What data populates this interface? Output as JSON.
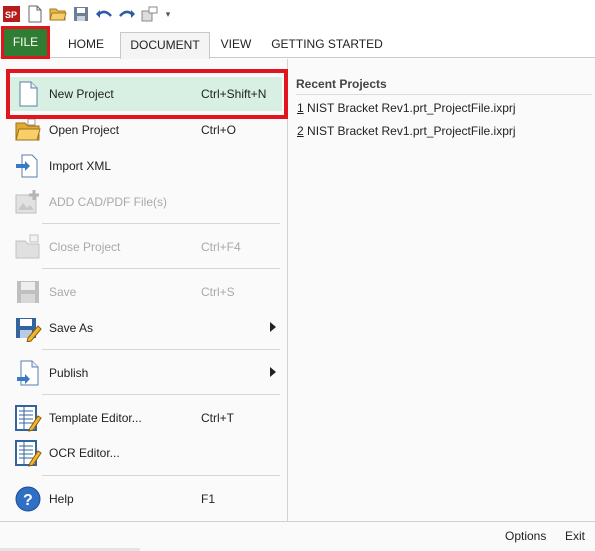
{
  "quick_access": {
    "icons": [
      "app-logo-icon",
      "new-file-icon",
      "open-folder-icon",
      "save-icon",
      "undo-icon",
      "redo-icon",
      "publish-icon",
      "customize-dropdown-icon"
    ]
  },
  "ribbon": {
    "file_label": "FILE",
    "tabs": [
      {
        "label": "HOME"
      },
      {
        "label": "DOCUMENT"
      },
      {
        "label": "VIEW"
      },
      {
        "label": "GETTING STARTED"
      }
    ],
    "active_tab": "DOCUMENT"
  },
  "menu": {
    "items": [
      {
        "label": "New Project",
        "shortcut": "Ctrl+Shift+N",
        "icon": "new-document-icon",
        "enabled": true,
        "selected": true
      },
      {
        "label": "Open Project",
        "shortcut": "Ctrl+O",
        "icon": "open-folder-icon",
        "enabled": true
      },
      {
        "label": "Import XML",
        "shortcut": "",
        "icon": "import-xml-icon",
        "enabled": true
      },
      {
        "label": "ADD CAD/PDF File(s)",
        "shortcut": "",
        "icon": "add-cad-pdf-icon",
        "enabled": false
      },
      {
        "label": "Close Project",
        "shortcut": "Ctrl+F4",
        "icon": "close-project-icon",
        "enabled": false
      },
      {
        "label": "Save",
        "shortcut": "Ctrl+S",
        "icon": "save-icon",
        "enabled": false
      },
      {
        "label": "Save As",
        "shortcut": "",
        "icon": "save-as-icon",
        "enabled": true,
        "submenu": true
      },
      {
        "label": "Publish",
        "shortcut": "",
        "icon": "publish-icon",
        "enabled": true,
        "submenu": true
      },
      {
        "label": "Template Editor...",
        "shortcut": "Ctrl+T",
        "icon": "template-editor-icon",
        "enabled": true
      },
      {
        "label": "OCR Editor...",
        "shortcut": "",
        "icon": "ocr-editor-icon",
        "enabled": true
      },
      {
        "label": "Help",
        "shortcut": "F1",
        "icon": "help-icon",
        "enabled": true
      }
    ]
  },
  "recent": {
    "title": "Recent Projects",
    "files": [
      {
        "num": "1",
        "name": " NIST Bracket Rev1.prt_ProjectFile.ixprj"
      },
      {
        "num": "2",
        "name": " NIST Bracket Rev1.prt_ProjectFile.ixprj"
      }
    ]
  },
  "footer": {
    "options_label": "Options",
    "exit_label": "Exit"
  },
  "colors": {
    "file_tab": "#2e7d32",
    "highlight_box": "#e2141d",
    "selected_item": "#d7f0e3"
  }
}
